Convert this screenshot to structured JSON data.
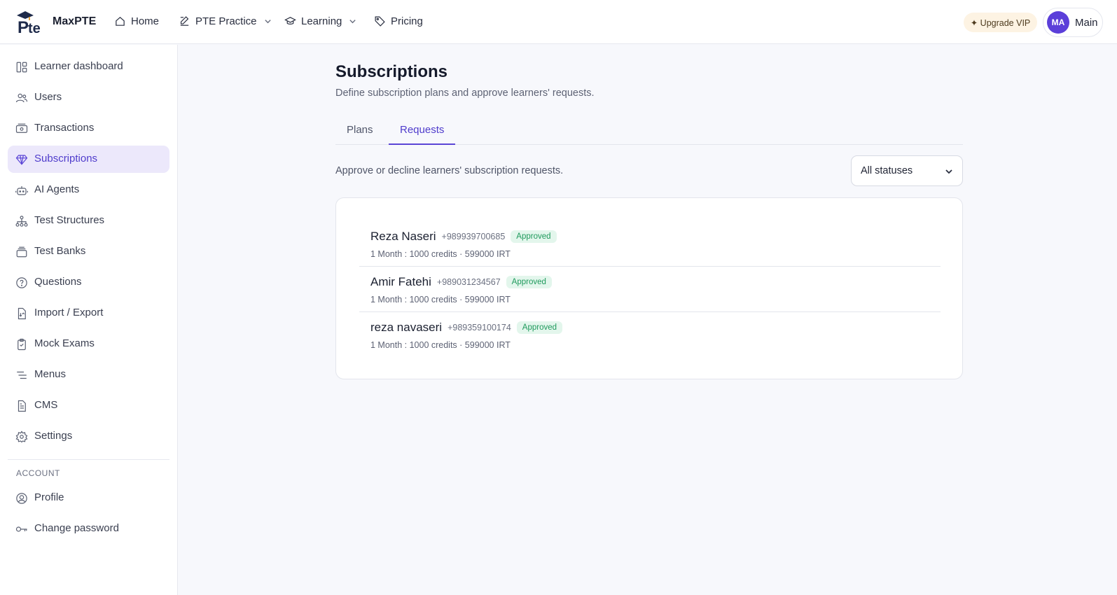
{
  "brand": {
    "name": "MaxPTE",
    "logo_icon": "pte-graduation-logo"
  },
  "nav": [
    {
      "label": "Home",
      "icon": "home-icon"
    },
    {
      "label": "PTE Practice",
      "icon": "edit-icon",
      "dropdown": true
    },
    {
      "label": "Learning",
      "icon": "graduation-cap-icon",
      "dropdown": true
    },
    {
      "label": "Pricing",
      "icon": "tag-icon"
    }
  ],
  "header": {
    "upgrade_label": "✦ Upgrade VIP",
    "avatar_initials": "MA",
    "user_name": "Main",
    "colors": {
      "accent": "#5b3fd9",
      "upgrade_bg": "#fdf3e3"
    }
  },
  "sidebar": {
    "items": [
      {
        "label": "Learner dashboard",
        "icon": "dashboard-icon"
      },
      {
        "label": "Users",
        "icon": "users-icon"
      },
      {
        "label": "Transactions",
        "icon": "cash-icon"
      },
      {
        "label": "Subscriptions",
        "icon": "diamond-icon",
        "active": true
      },
      {
        "label": "AI Agents",
        "icon": "robot-icon"
      },
      {
        "label": "Test Structures",
        "icon": "hierarchy-icon"
      },
      {
        "label": "Test Banks",
        "icon": "stack-icon"
      },
      {
        "label": "Questions",
        "icon": "question-icon"
      },
      {
        "label": "Import / Export",
        "icon": "file-transfer-icon"
      },
      {
        "label": "Mock Exams",
        "icon": "clipboard-icon"
      },
      {
        "label": "Menus",
        "icon": "menu-lines-icon"
      },
      {
        "label": "CMS",
        "icon": "document-icon"
      },
      {
        "label": "Settings",
        "icon": "gear-icon"
      }
    ],
    "account_section": "ACCOUNT",
    "account_items": [
      {
        "label": "Profile",
        "icon": "user-circle-icon"
      },
      {
        "label": "Change password",
        "icon": "key-icon"
      }
    ]
  },
  "main": {
    "title": "Subscriptions",
    "subtitle": "Define subscription plans and approve learners' requests.",
    "tabs": [
      {
        "label": "Plans",
        "active": false
      },
      {
        "label": "Requests",
        "active": true
      }
    ],
    "requests_description": "Approve or decline learners' subscription requests.",
    "status_filter": {
      "selected": "All statuses"
    },
    "requests": [
      {
        "name": "Reza Naseri",
        "phone": "+989939700685",
        "status": "Approved",
        "details": "1 Month : 1000 credits · 599000 IRT"
      },
      {
        "name": "Amir Fatehi",
        "phone": "+989031234567",
        "status": "Approved",
        "details": "1 Month : 1000 credits · 599000 IRT"
      },
      {
        "name": "reza navaseri",
        "phone": "+989359100174",
        "status": "Approved",
        "details": "1 Month : 1000 credits · 599000 IRT"
      }
    ]
  }
}
